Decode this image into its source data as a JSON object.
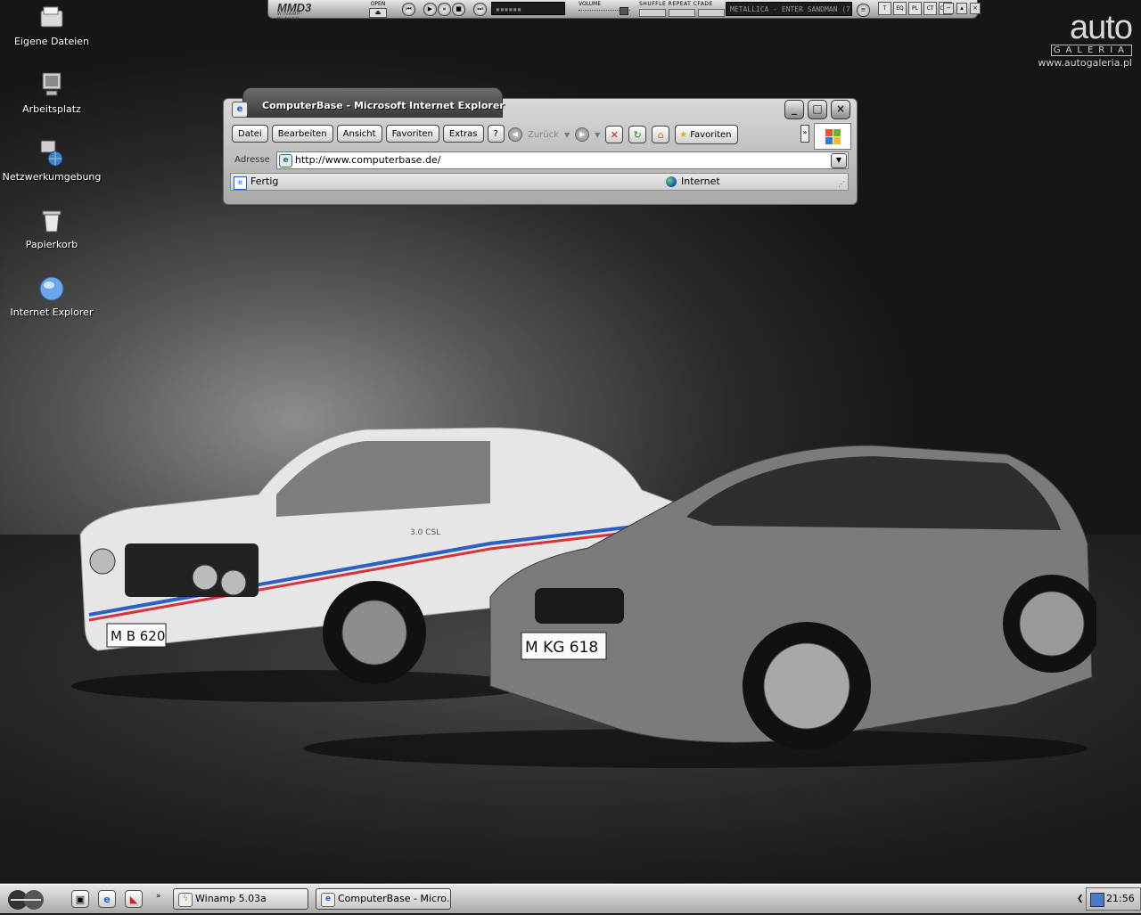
{
  "desktop": {
    "icons": [
      {
        "label": "Eigene Dateien",
        "icon": "my-documents-icon"
      },
      {
        "label": "Arbeitsplatz",
        "icon": "my-computer-icon"
      },
      {
        "label": "Netzwerkumgebung",
        "icon": "network-places-icon"
      },
      {
        "label": "Papierkorb",
        "icon": "recycle-bin-icon"
      },
      {
        "label": "Internet Explorer",
        "icon": "internet-explorer-icon"
      }
    ]
  },
  "branding": {
    "logo": "auto",
    "sub": "GALERIA",
    "url": "www.autogaleria.pl"
  },
  "winamp": {
    "skin_logo": "MMD3",
    "skin_sub": "WINAMP-PLAYER",
    "open_label": "OPEN",
    "volume_label": "VOLUME",
    "modes_label": "SHUFFLE REPEAT CFADE",
    "track": "METALLICA - ENTER SANDMAN (7:39)",
    "tabs": [
      "T",
      "EQ",
      "PL",
      "CT",
      "CFG"
    ]
  },
  "ie_window": {
    "title": "ComputerBase - Microsoft Internet Explorer",
    "menu": [
      "Datei",
      "Bearbeiten",
      "Ansicht",
      "Favoriten",
      "Extras",
      "?"
    ],
    "back_label": "Zurück",
    "favorites_button": "Favoriten",
    "address_label": "Adresse",
    "address_value": "http://www.computerbase.de/",
    "status_left": "Fertig",
    "status_zone": "Internet"
  },
  "wallpaper": {
    "plate_left": "M B 620",
    "plate_right": "M KG 618",
    "badge": "3.0 CSL"
  },
  "taskbar": {
    "tasks": [
      {
        "label": "Winamp 5.03a"
      },
      {
        "label": "ComputerBase - Micro..."
      }
    ],
    "clock": "21:56"
  }
}
